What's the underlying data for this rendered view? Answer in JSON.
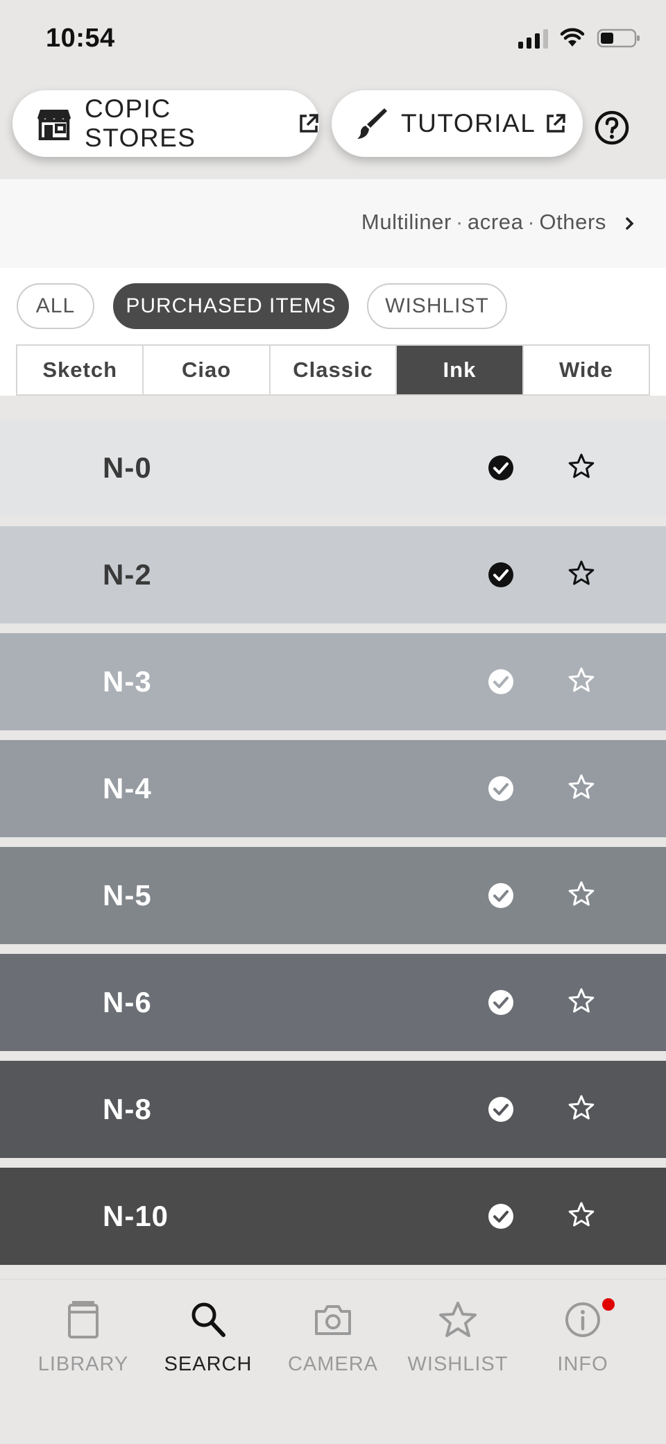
{
  "status": {
    "time": "10:54"
  },
  "header": {
    "stores_label": "COPIC STORES",
    "tutorial_label": "TUTORIAL"
  },
  "breadcrumb": [
    "Multiliner",
    "acrea",
    "Others"
  ],
  "filters": {
    "chips": [
      {
        "label": "ALL",
        "active": false
      },
      {
        "label": "PURCHASED ITEMS",
        "active": true
      },
      {
        "label": "WISHLIST",
        "active": false
      }
    ],
    "segments": [
      {
        "label": "Sketch",
        "active": false
      },
      {
        "label": "Ciao",
        "active": false
      },
      {
        "label": "Classic",
        "active": false
      },
      {
        "label": "Ink",
        "active": true
      },
      {
        "label": "Wide",
        "active": false
      }
    ]
  },
  "colors": [
    {
      "name": "N-0",
      "bg": "#e3e4e6",
      "text": "#3a3a3a",
      "purchased": true,
      "dark_icons": true
    },
    {
      "name": "N-2",
      "bg": "#c8ccd0",
      "text": "#3a3a3a",
      "purchased": true,
      "dark_icons": true
    },
    {
      "name": "N-3",
      "bg": "#abb0b6",
      "text": "#ffffff",
      "purchased": false,
      "dark_icons": false
    },
    {
      "name": "N-4",
      "bg": "#959ba0",
      "text": "#ffffff",
      "purchased": false,
      "dark_icons": false
    },
    {
      "name": "N-5",
      "bg": "#81868b",
      "text": "#ffffff",
      "purchased": false,
      "dark_icons": false
    },
    {
      "name": "N-6",
      "bg": "#6b6f75",
      "text": "#ffffff",
      "purchased": false,
      "dark_icons": false
    },
    {
      "name": "N-8",
      "bg": "#55575a",
      "text": "#ffffff",
      "purchased": false,
      "dark_icons": false
    },
    {
      "name": "N-10",
      "bg": "#4b4b4c",
      "text": "#ffffff",
      "purchased": false,
      "dark_icons": false
    }
  ],
  "nav": [
    {
      "label": "LIBRARY",
      "icon": "book-icon",
      "active": false
    },
    {
      "label": "SEARCH",
      "icon": "search-icon",
      "active": true
    },
    {
      "label": "CAMERA",
      "icon": "camera-icon",
      "active": false
    },
    {
      "label": "WISHLIST",
      "icon": "star-icon",
      "active": false
    },
    {
      "label": "INFO",
      "icon": "info-icon",
      "active": false
    }
  ],
  "accent_colors": {
    "active_dark": "#4a4a4a",
    "badge": "#e00000"
  }
}
